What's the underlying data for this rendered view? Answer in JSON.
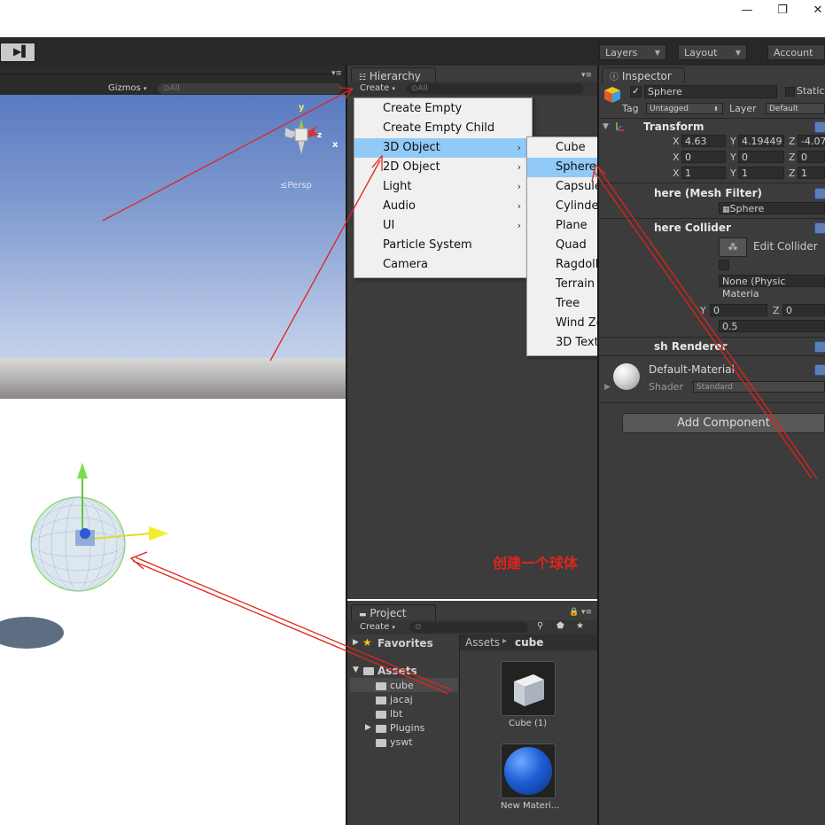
{
  "window": {
    "minimize_glyph": "—",
    "restore_glyph": "❐",
    "close_glyph": "✕"
  },
  "toolbar": {
    "step_glyph": "▶▌",
    "layers_label": "Layers",
    "layout_label": "Layout",
    "account_label": "Account"
  },
  "scene": {
    "gizmos_label": "Gizmos",
    "search_placeholder": "⊙All",
    "persp_label": "≤Persp",
    "gizmo_axes": {
      "y": "y",
      "x": "x",
      "z": "z"
    }
  },
  "hierarchy": {
    "tab_label": "Hierarchy",
    "create_label": "Create",
    "search_placeholder": "⊙All"
  },
  "create_menu": {
    "items": [
      {
        "label": "Create Empty",
        "submenu": false,
        "selected": false
      },
      {
        "label": "Create Empty Child",
        "submenu": false,
        "selected": false
      },
      {
        "label": "3D Object",
        "submenu": true,
        "selected": true
      },
      {
        "label": "2D Object",
        "submenu": true,
        "selected": false
      },
      {
        "label": "Light",
        "submenu": true,
        "selected": false
      },
      {
        "label": "Audio",
        "submenu": true,
        "selected": false
      },
      {
        "label": "UI",
        "submenu": true,
        "selected": false
      },
      {
        "label": "Particle System",
        "submenu": false,
        "selected": false
      },
      {
        "label": "Camera",
        "submenu": false,
        "selected": false
      }
    ],
    "arrow_glyph": "›"
  },
  "object_submenu": {
    "items": [
      {
        "label": "Cube",
        "selected": false
      },
      {
        "label": "Sphere",
        "selected": true
      },
      {
        "label": "Capsule",
        "selected": false
      },
      {
        "label": "Cylinder",
        "selected": false
      },
      {
        "label": "Plane",
        "selected": false
      },
      {
        "label": "Quad",
        "selected": false
      },
      {
        "label": "Ragdoll...",
        "selected": false
      },
      {
        "label": "Terrain",
        "selected": false
      },
      {
        "label": "Tree",
        "selected": false
      },
      {
        "label": "Wind Zone",
        "selected": false
      },
      {
        "label": "3D Text",
        "selected": false
      }
    ]
  },
  "inspector": {
    "tab_label": "Inspector",
    "object_name": "Sphere",
    "static_label": "Static",
    "tag_label": "Tag",
    "tag_value": "Untagged",
    "layer_label": "Layer",
    "layer_value": "Default",
    "transform_label": "Transform",
    "position": {
      "x_label": "X",
      "x": "4.63",
      "y_label": "Y",
      "y": "4.19449",
      "z_label": "Z",
      "z": "-4.07"
    },
    "rotation": {
      "x_label": "X",
      "x": "0",
      "y_label": "Y",
      "y": "0",
      "z_label": "Z",
      "z": "0"
    },
    "scale": {
      "x_label": "X",
      "x": "1",
      "y_label": "Y",
      "y": "1",
      "z_label": "Z",
      "z": "1"
    },
    "mesh_filter_label": "here (Mesh Filter)",
    "mesh_value": "Sphere",
    "collider_label": "here Collider",
    "edit_collider_label": "Edit Collider",
    "material_value": "None (Physic Materia",
    "center_y_label": "Y",
    "center_y": "0",
    "center_z_label": "Z",
    "center_z": "0",
    "radius_value": "0.5",
    "renderer_label": "sh Renderer",
    "material_name": "Default-Material",
    "shader_label": "Shader",
    "shader_value": "Standard",
    "add_component_label": "Add Component"
  },
  "project": {
    "tab_label": "Project",
    "create_label": "Create",
    "search_placeholder": "⊙",
    "favorites_label": "Favorites",
    "assets_label": "Assets",
    "folders": [
      "cube",
      "jacaj",
      "lbt",
      "Plugins",
      "yswt"
    ],
    "breadcrumb_root": "Assets",
    "breadcrumb_sep": "▸",
    "breadcrumb_current": "cube",
    "items": [
      {
        "label": "Cube (1)"
      },
      {
        "label": "New Materi..."
      }
    ]
  },
  "annotation": {
    "text": "创建一个球体",
    "color": "#e0241b"
  },
  "colors": {
    "accent_selection": "#91c9f7",
    "panel_bg": "#3c3c3c"
  }
}
